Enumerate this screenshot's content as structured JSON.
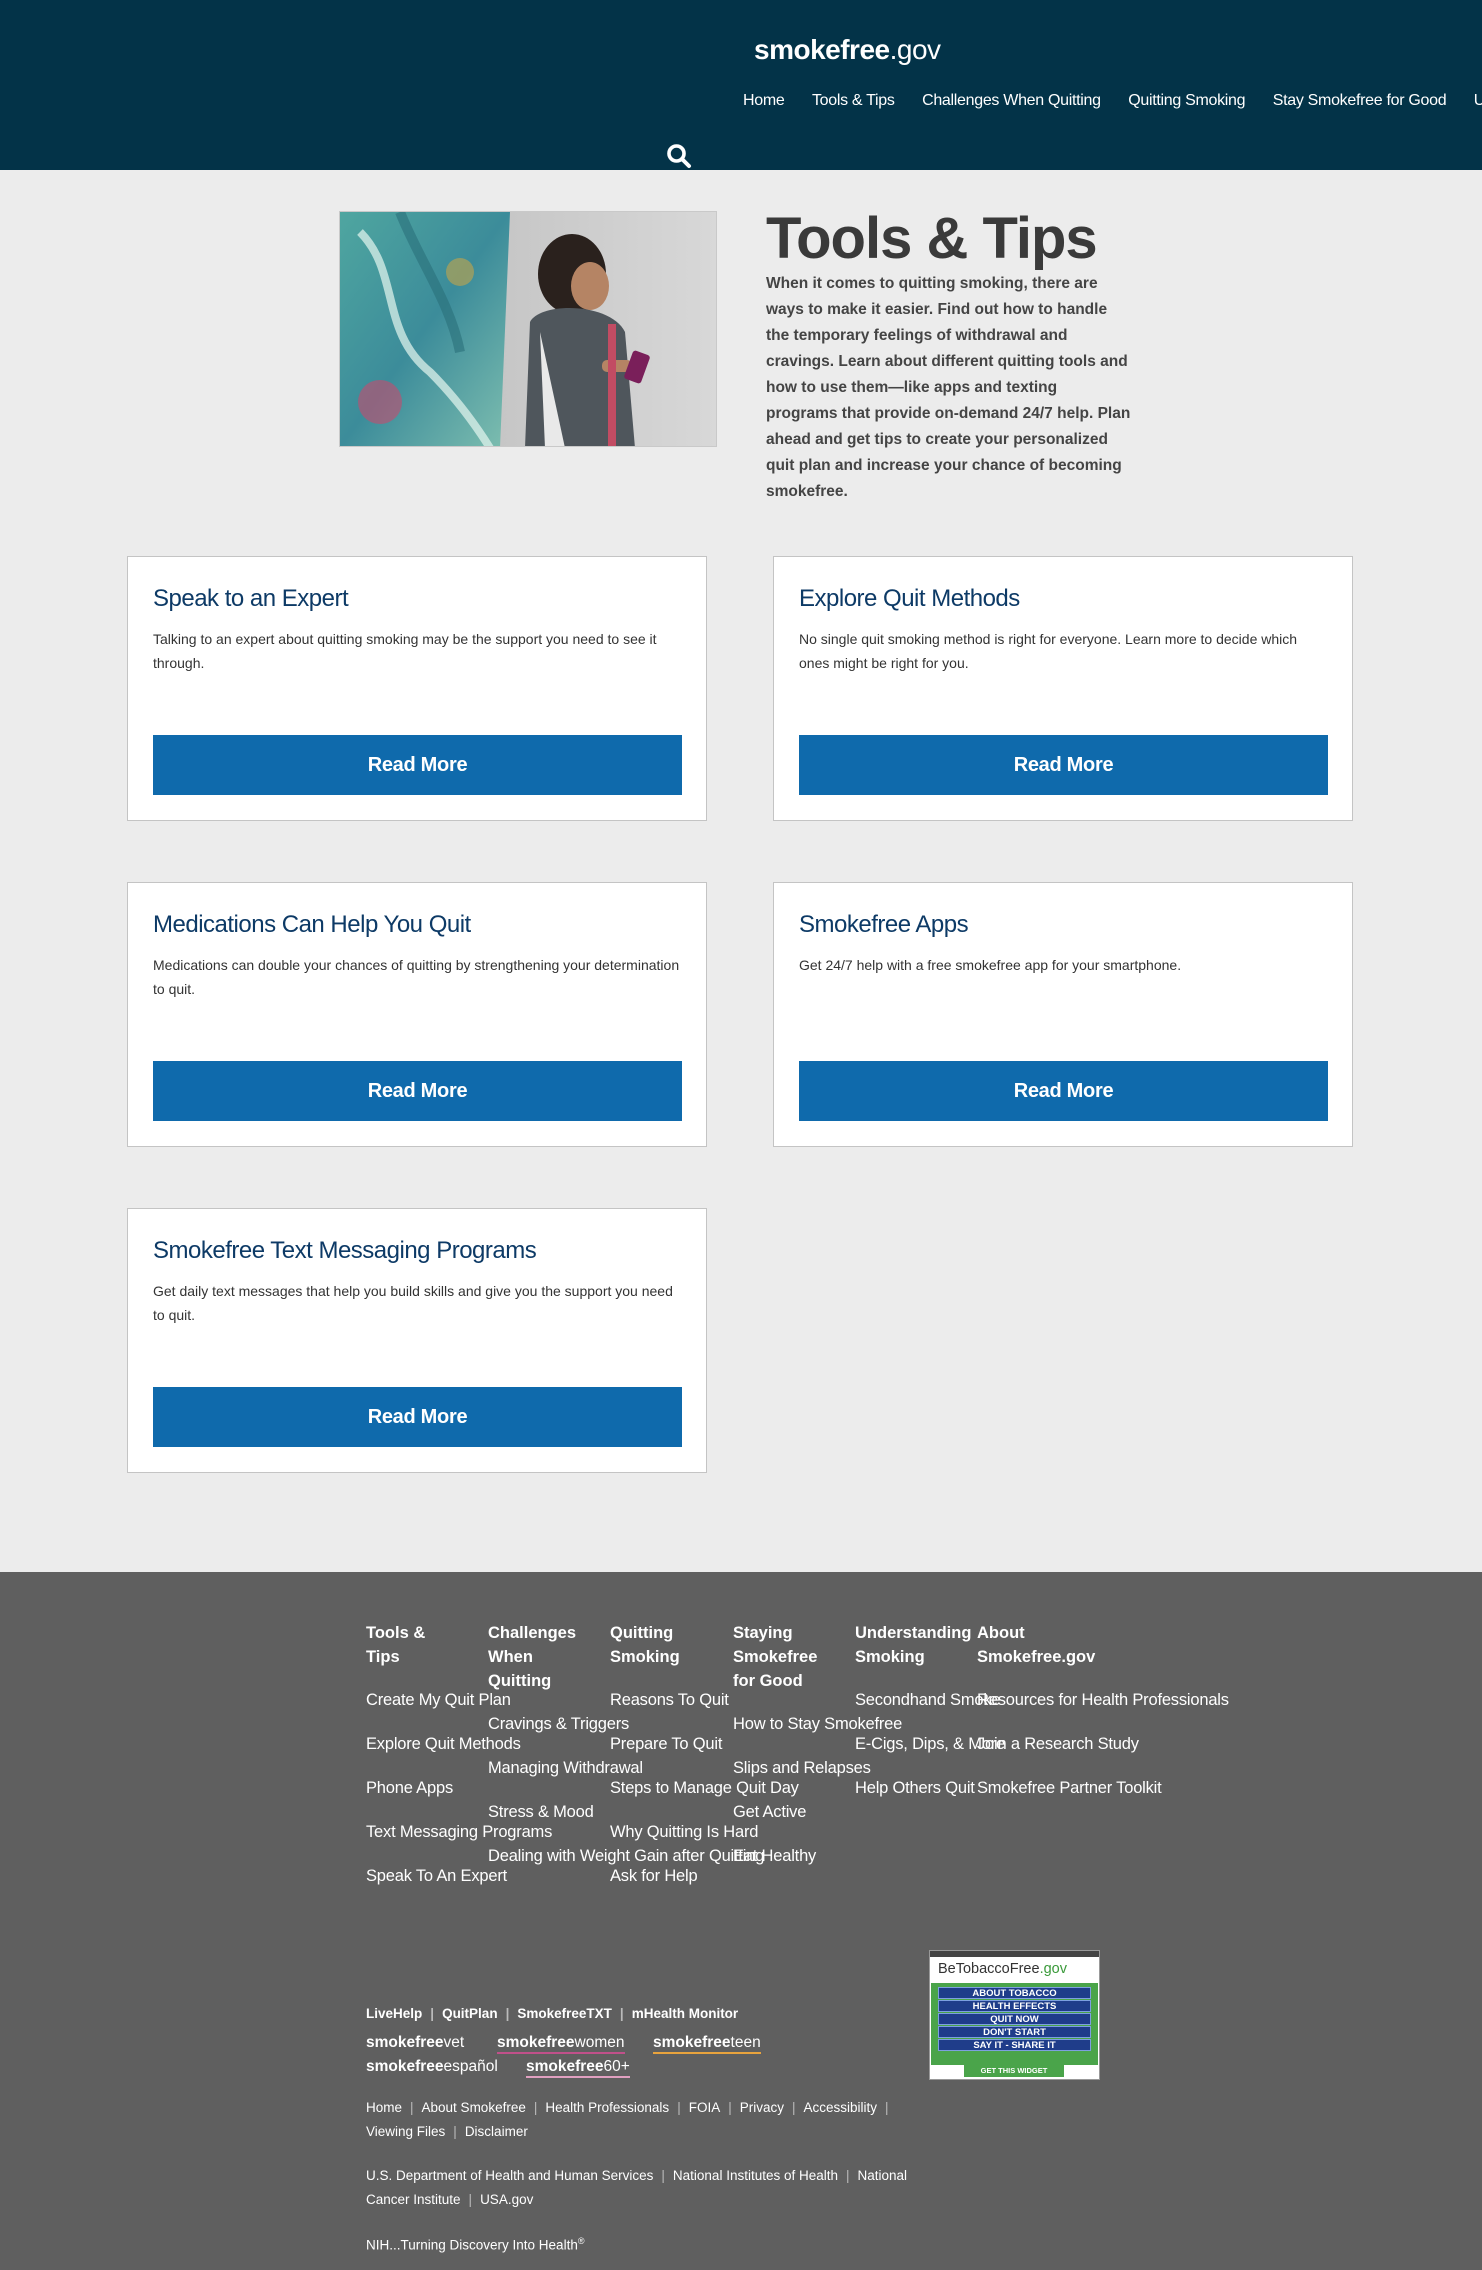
{
  "header": {
    "logo_bold": "smokefree",
    "logo_light": ".gov",
    "nav": [
      "Home",
      "Tools & Tips",
      "Challenges When Quitting",
      "Quitting Smoking",
      "Stay Smokefree for Good",
      "Understa"
    ]
  },
  "hero": {
    "title": "Tools & Tips",
    "text": "When it comes to quitting smoking, there are ways to make it easier. Find out how to handle the temporary feelings of withdrawal and cravings. Learn about different quitting tools and how to use them—like apps and texting programs that provide on-demand 24/7 help. Plan ahead and get tips to create your personalized quit plan and increase your chance of becoming smokefree."
  },
  "cards": [
    {
      "title": "Speak to an Expert",
      "text": "Talking to an expert about quitting smoking may be the support you need to see it through.",
      "button": "Read More"
    },
    {
      "title": "Explore Quit Methods",
      "text": "No single quit smoking method is right for everyone. Learn more to decide which ones might be right for you.",
      "button": "Read More"
    },
    {
      "title": "Medications Can Help You Quit",
      "text": "Medications can double your chances of quitting by strengthening your determination to quit.",
      "button": "Read More"
    },
    {
      "title": "Smokefree Apps",
      "text": "Get 24/7 help with a free smokefree app for your smartphone.",
      "button": "Read More"
    },
    {
      "title": "Smokefree Text Messaging Programs",
      "text": "Get daily text messages that help you build skills and give you the support you need to quit.",
      "button": "Read More"
    }
  ],
  "footer": {
    "columns": [
      {
        "heading": "Tools & Tips",
        "links": [
          "Create My Quit Plan",
          "Explore Quit Methods",
          "Phone Apps",
          "Text Messaging Programs",
          "Speak To An Expert"
        ]
      },
      {
        "heading": "Challenges When Quitting",
        "links": [
          "Cravings & Triggers",
          "Managing Withdrawal",
          "Stress & Mood",
          "Dealing with Weight Gain after Quitting"
        ]
      },
      {
        "heading": "Quitting Smoking",
        "links": [
          "Reasons To Quit",
          "Prepare To Quit",
          "Steps to Manage Quit Day",
          "Why Quitting Is Hard",
          "Ask for Help"
        ]
      },
      {
        "heading": "Staying Smokefree for Good",
        "links": [
          "How to Stay Smokefree",
          "Slips and Relapses",
          "Get Active",
          "Eat Healthy"
        ]
      },
      {
        "heading": "Understanding Smoking",
        "links": [
          "Secondhand Smoke",
          "E-Cigs, Dips, & More",
          "Help Others Quit"
        ]
      },
      {
        "heading": "About Smokefree.gov",
        "links": [
          "Resources for Health Professionals",
          "Join a Research Study",
          "Smokefree Partner Toolkit"
        ]
      }
    ],
    "programs": [
      "LiveHelp",
      "QuitPlan",
      "SmokefreeTXT",
      "mHealth Monitor"
    ],
    "sites": [
      {
        "bold": "smokefree",
        "light": "vet",
        "color": "#999999"
      },
      {
        "bold": "smokefree",
        "light": "women",
        "color": "#c0508a"
      },
      {
        "bold": "smokefree",
        "light": "teen",
        "color": "#e8a33d"
      },
      {
        "bold": "smokefree",
        "light": "español",
        "color": "#5f5f5f"
      },
      {
        "bold": "smokefree",
        "light": "60+",
        "color": "#e0a0c0"
      }
    ],
    "legal_row1": [
      "Home",
      "About Smokefree",
      "Health Professionals",
      "FOIA",
      "Privacy",
      "Accessibility"
    ],
    "legal_row2": [
      "Viewing Files",
      "Disclaimer"
    ],
    "gov_row1": [
      "U.S. Department of Health and Human Services",
      "National Institutes of Health",
      "National"
    ],
    "gov_row2": [
      "Cancer Institute",
      "USA.gov"
    ],
    "tagline": "NIH...Turning Discovery Into Health",
    "tagline_mark": "®",
    "widget": {
      "brand_a": "BeTobaccoFree",
      "brand_b": ".gov",
      "items": [
        "ABOUT TOBACCO",
        "HEALTH EFFECTS",
        "QUIT NOW",
        "DON'T START",
        "SAY IT - SHARE IT"
      ],
      "cta": "GET THIS WIDGET"
    }
  }
}
